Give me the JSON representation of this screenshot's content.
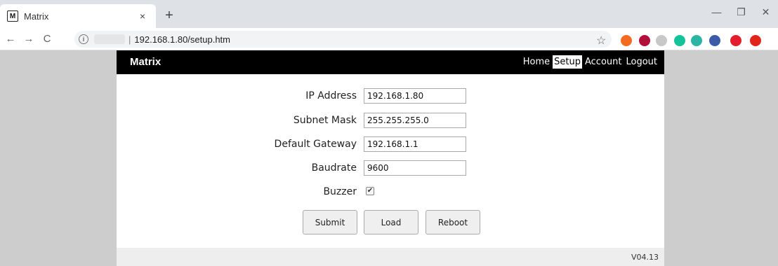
{
  "browser": {
    "tab_title": "Matrix",
    "favicon_letter": "M",
    "tab_close": "×",
    "new_tab": "+",
    "url": "192.168.1.80/setup.htm",
    "window_controls": {
      "minimize": "—",
      "restore": "❐",
      "close": "✕"
    },
    "nav": {
      "back": "←",
      "forward": "→",
      "reload": "C"
    },
    "extensions": [
      {
        "name": "extension-orange",
        "color": "#f26b21"
      },
      {
        "name": "extension-k",
        "color": "#b0103a"
      },
      {
        "name": "extension-gray",
        "color": "#c8c8c8"
      },
      {
        "name": "extension-grammarly",
        "color": "#15c39a"
      },
      {
        "name": "extension-teal",
        "color": "#2bb5a5"
      },
      {
        "name": "extension-blue",
        "color": "#3b5aa8"
      },
      {
        "name": "extension-red-arrow",
        "color": "#e31d2b"
      },
      {
        "name": "extension-red-o",
        "color": "#e0251b"
      }
    ]
  },
  "site": {
    "brand": "Matrix",
    "nav": [
      "Home",
      "Setup",
      "Account",
      "Logout"
    ],
    "active_nav": "Setup"
  },
  "form": {
    "ip_label": "IP Address",
    "ip_value": "192.168.1.80",
    "subnet_label": "Subnet Mask",
    "subnet_value": "255.255.255.0",
    "gateway_label": "Default Gateway",
    "gateway_value": "192.168.1.1",
    "baud_label": "Baudrate",
    "baud_value": "9600",
    "buzzer_label": "Buzzer",
    "buzzer_checked": true
  },
  "buttons": {
    "submit": "Submit",
    "load": "Load",
    "reboot": "Reboot"
  },
  "footer": {
    "version": "V04.13"
  }
}
